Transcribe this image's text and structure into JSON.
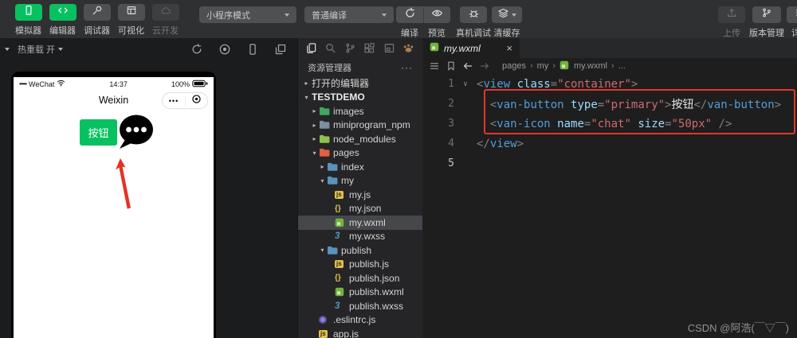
{
  "toolbar": {
    "panel_buttons": [
      {
        "label": "模拟器",
        "icon": "phone-icon",
        "active": true,
        "enabled": true
      },
      {
        "label": "编辑器",
        "icon": "code-icon",
        "active": true,
        "enabled": true
      },
      {
        "label": "调试器",
        "icon": "debug-icon",
        "active": false,
        "enabled": true
      },
      {
        "label": "可视化",
        "icon": "layout-icon",
        "active": false,
        "enabled": true
      },
      {
        "label": "云开发",
        "icon": "cloud-icon",
        "active": false,
        "enabled": false
      }
    ],
    "mode_dropdown": "小程序模式",
    "compile_dropdown": "普通编译",
    "actions": [
      {
        "label": "编译",
        "icon": "compile-icon"
      },
      {
        "label": "预览",
        "icon": "preview-icon"
      },
      {
        "label": "真机调试",
        "icon": "device-debug-icon"
      },
      {
        "label": "清缓存",
        "icon": "clear-cache-icon"
      }
    ],
    "right_actions": [
      {
        "label": "上传",
        "icon": "upload-icon",
        "enabled": false
      },
      {
        "label": "版本管理",
        "icon": "version-icon",
        "enabled": true
      },
      {
        "label": "详情",
        "icon": "details-icon",
        "enabled": true
      }
    ]
  },
  "simulator": {
    "hot_reload": "热重载 开",
    "toolbar_icons": [
      "refresh-icon",
      "record-icon",
      "phone-outline-icon",
      "windows-icon"
    ],
    "phone": {
      "signal": "•••••",
      "carrier": "WeChat",
      "time": "14:37",
      "battery": "100%",
      "nav_title": "Weixin",
      "capsule_dots": "•••",
      "button_label": "按钮"
    }
  },
  "explorer": {
    "activity_icons": [
      "files-icon",
      "search-icon",
      "source-control-icon",
      "extensions-icon",
      "window-icon",
      "paw-icon"
    ],
    "title": "资源管理器",
    "more": "···",
    "tree": [
      {
        "label": "打开的编辑器",
        "type": "section",
        "arrow": "right",
        "indent": 0
      },
      {
        "label": "TESTDEMO",
        "type": "root",
        "arrow": "down",
        "indent": 0,
        "bold": true
      },
      {
        "label": "images",
        "type": "folder",
        "arrow": "right",
        "indent": 1,
        "color": "#43a564"
      },
      {
        "label": "miniprogram_npm",
        "type": "folder",
        "arrow": "right",
        "indent": 1,
        "color": "#7f8fa0"
      },
      {
        "label": "node_modules",
        "type": "folder",
        "arrow": "right",
        "indent": 1,
        "color": "#8dc149"
      },
      {
        "label": "pages",
        "type": "folder",
        "arrow": "down",
        "indent": 1,
        "color": "#e25f3f"
      },
      {
        "label": "index",
        "type": "folder",
        "arrow": "right",
        "indent": 2,
        "color": "#5a93b8"
      },
      {
        "label": "my",
        "type": "folder",
        "arrow": "down",
        "indent": 2,
        "color": "#5a93b8"
      },
      {
        "label": "my.js",
        "type": "file",
        "icon": "js",
        "indent": 3
      },
      {
        "label": "my.json",
        "type": "file",
        "icon": "json",
        "indent": 3
      },
      {
        "label": "my.wxml",
        "type": "file",
        "icon": "wxml",
        "indent": 3,
        "selected": true
      },
      {
        "label": "my.wxss",
        "type": "file",
        "icon": "wxss",
        "indent": 3
      },
      {
        "label": "publish",
        "type": "folder",
        "arrow": "down",
        "indent": 2,
        "color": "#5a93b8"
      },
      {
        "label": "publish.js",
        "type": "file",
        "icon": "js",
        "indent": 3
      },
      {
        "label": "publish.json",
        "type": "file",
        "icon": "json",
        "indent": 3
      },
      {
        "label": "publish.wxml",
        "type": "file",
        "icon": "wxml",
        "indent": 3
      },
      {
        "label": "publish.wxss",
        "type": "file",
        "icon": "wxss",
        "indent": 3
      },
      {
        "label": ".eslintrc.js",
        "type": "file",
        "icon": "eslint",
        "indent": 1
      },
      {
        "label": "app.js",
        "type": "file",
        "icon": "js",
        "indent": 1
      }
    ]
  },
  "editor": {
    "tab": {
      "name": "my.wxml"
    },
    "breadcrumb": [
      {
        "label": "pages"
      },
      {
        "label": "my"
      },
      {
        "label": "my.wxml",
        "icon": "wxml-file-icon"
      },
      {
        "label": "..."
      }
    ],
    "code": {
      "lines": [
        {
          "num": "1",
          "fold": true,
          "tokens": [
            [
              "p",
              "<"
            ],
            [
              "t",
              "view"
            ],
            [
              "w",
              " "
            ],
            [
              "a",
              "class"
            ],
            [
              "p",
              "="
            ],
            [
              "s",
              "\"container\""
            ],
            [
              "p",
              ">"
            ]
          ]
        },
        {
          "num": "2",
          "boxed": true,
          "tokens": [
            [
              "w",
              "  "
            ],
            [
              "p",
              "<"
            ],
            [
              "t",
              "van-button"
            ],
            [
              "w",
              " "
            ],
            [
              "a",
              "type"
            ],
            [
              "p",
              "="
            ],
            [
              "s",
              "\"primary\""
            ],
            [
              "p",
              ">"
            ],
            [
              "x",
              "按钮"
            ],
            [
              "p",
              "</"
            ],
            [
              "t",
              "van-button"
            ],
            [
              "p",
              ">"
            ]
          ]
        },
        {
          "num": "3",
          "boxed": true,
          "tokens": [
            [
              "w",
              "  "
            ],
            [
              "p",
              "<"
            ],
            [
              "t",
              "van-icon"
            ],
            [
              "w",
              " "
            ],
            [
              "a",
              "name"
            ],
            [
              "p",
              "="
            ],
            [
              "s",
              "\"chat\""
            ],
            [
              "w",
              " "
            ],
            [
              "a",
              "size"
            ],
            [
              "p",
              "="
            ],
            [
              "s",
              "\"50px\""
            ],
            [
              "w",
              " "
            ],
            [
              "p",
              "/>"
            ]
          ]
        },
        {
          "num": "4",
          "tokens": [
            [
              "p",
              "</"
            ],
            [
              "t",
              "view"
            ],
            [
              "p",
              ">"
            ]
          ]
        },
        {
          "num": "5",
          "active": true,
          "tokens": []
        }
      ]
    }
  },
  "watermark": "CSDN @阿浩(￣▽￣)",
  "colors": {
    "accent_green": "#07c160",
    "annotation_red": "#e5352b",
    "tag": "#569cd6",
    "attr": "#9cdcfe",
    "string": "#ce6a6a"
  }
}
